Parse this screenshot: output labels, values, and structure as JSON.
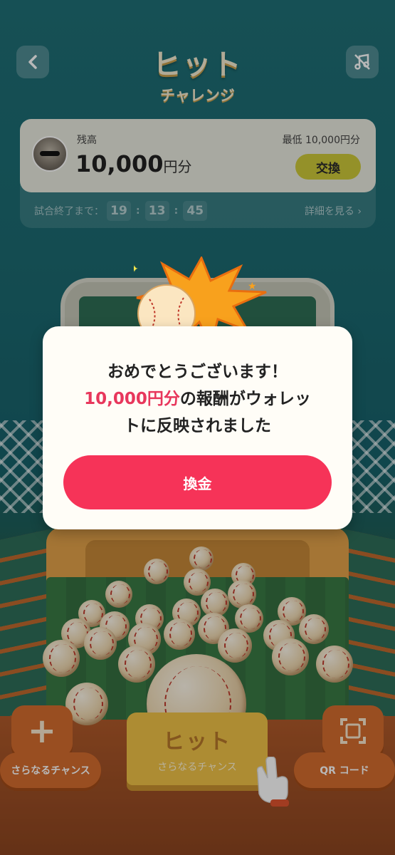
{
  "header": {
    "title": "ヒット",
    "subtitle": "チャレンジ"
  },
  "balance": {
    "label": "残高",
    "amount": "10,000",
    "unit": "円分",
    "minimum": "最低 10,000円分",
    "exchange_label": "交換"
  },
  "timer": {
    "label": "試合終了まで：",
    "hours": "19",
    "minutes": "13",
    "seconds": "45",
    "details_label": "詳細を見る ›"
  },
  "dialog": {
    "line1": "おめでとうございます！",
    "amount": "10,000円分",
    "line2_rest": "の報酬がウォレッ",
    "line3": "トに反映されました",
    "button_label": "換金"
  },
  "controls": {
    "more_chances_label": "さらなるチャンス",
    "hit_label": "ヒット",
    "hit_sub_label": "さらなるチャンス",
    "qr_label": "QR コード"
  },
  "colors": {
    "accent_red": "#f63358",
    "exchange_yellow": "#cdc93a",
    "background_teal": "#1f6f76"
  }
}
